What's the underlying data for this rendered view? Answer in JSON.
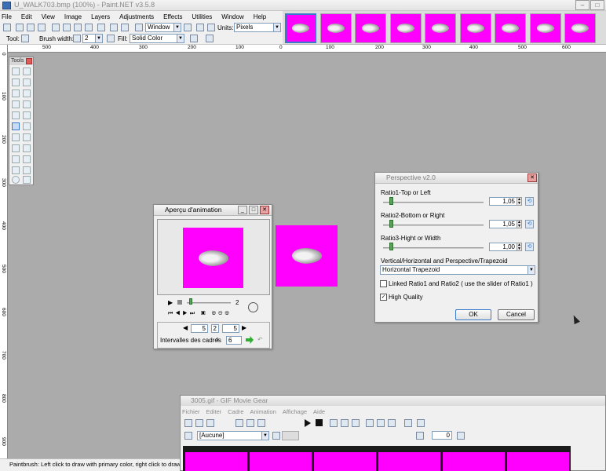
{
  "window": {
    "title": "U_WALK703.bmp (100%) - Paint.NET v3.5.8"
  },
  "menu": [
    "File",
    "Edit",
    "View",
    "Image",
    "Layers",
    "Adjustments",
    "Effects",
    "Utilities",
    "Window",
    "Help"
  ],
  "toolbar": {
    "zoom_combo": "Window",
    "units_label": "Units:",
    "units_value": "Pixels"
  },
  "toolbar2": {
    "tool_label": "Tool:",
    "brush_width_label": "Brush width:",
    "brush_width_value": "2",
    "fill_label": "Fill:",
    "fill_value": "Solid Color"
  },
  "ruler": {
    "h_ticks": [
      "500",
      "400",
      "300",
      "200",
      "100",
      "0",
      "100",
      "200",
      "300",
      "400",
      "500",
      "600"
    ],
    "v_ticks": [
      "0",
      "100",
      "200",
      "300",
      "400",
      "500",
      "600",
      "700",
      "800",
      "900"
    ]
  },
  "tools_window": {
    "title": "Tools"
  },
  "preview_dialog": {
    "title": "Aperçu d'animation",
    "frame_counter": "2",
    "nav_left": "5",
    "nav_mid": "2",
    "nav_right": "5",
    "interval_label": "Intervalles des cadres",
    "interval_value": "6"
  },
  "perspective_dialog": {
    "title": "Perspective  v2.0",
    "ratio1_label": "Ratio1-Top or Left",
    "ratio1_value": "1,05",
    "ratio2_label": "Ratio2-Bottom or Right",
    "ratio2_value": "1,05",
    "ratio3_label": "Ratio3-Hight or Width",
    "ratio3_value": "1,00",
    "mode_label": "Vertical/Horizontal and Perspective/Trapezoid",
    "mode_value": "Horizontal Trapezoid",
    "linked_label": "Linked Ratio1 and Ratio2 ( use the slider of Ratio1 )",
    "quality_label": "High Quality",
    "ok_label": "OK",
    "cancel_label": "Cancel"
  },
  "gmg": {
    "title": "3005.gif - GIF Movie Gear",
    "menu": [
      "Fichier",
      "Editer",
      "Cadre",
      "Animation",
      "Affichage",
      "Aide"
    ],
    "combo_value": "[Aucune]",
    "loop_value": "0"
  },
  "status": {
    "text": "Paintbrush: Left click to draw with primary color, right click to draw with secondary color"
  },
  "colors": {
    "magenta": "#ff00ff",
    "canvas_bg": "#ababab",
    "accent": "#3a78c8"
  }
}
